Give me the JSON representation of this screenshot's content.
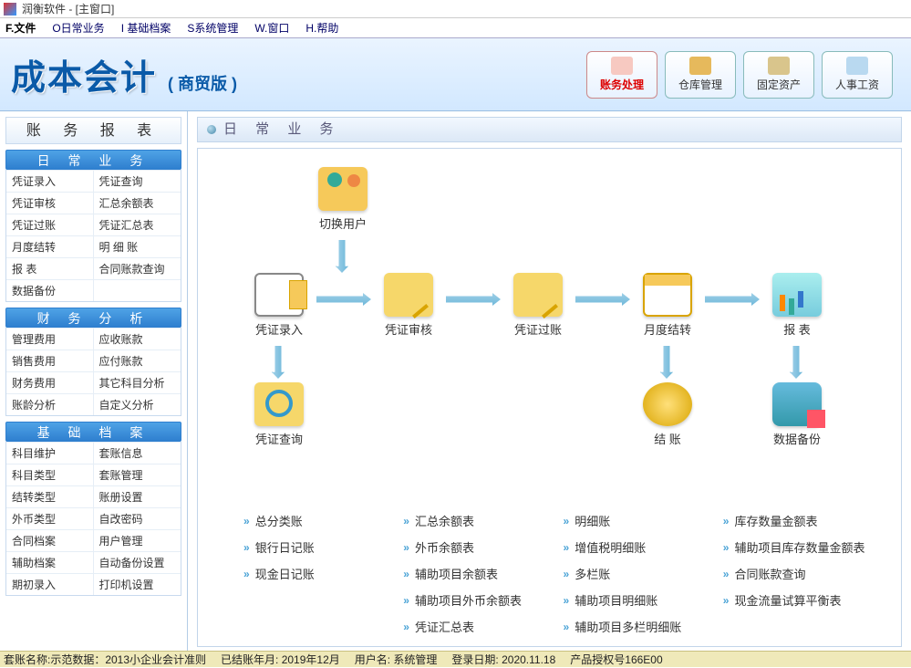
{
  "window": {
    "title": "润衡软件 - [主窗口]"
  },
  "menu": {
    "file": "F.文件",
    "daily": "O日常业务",
    "base": "I 基础档案",
    "system": "S系统管理",
    "window": "W.窗口",
    "help": "H.帮助"
  },
  "brand": {
    "title": "成本会计",
    "edition": "( 商贸版 )"
  },
  "toolbar": {
    "b1": "账务处理",
    "b2": "仓库管理",
    "b3": "固定资产",
    "b4": "人事工资"
  },
  "sidebar": {
    "title": "账 务 报 表",
    "g1": {
      "hdr": "日 常 业 务",
      "items": [
        "凭证录入",
        "凭证查询",
        "凭证审核",
        "汇总余额表",
        "凭证过账",
        "凭证汇总表",
        "月度结转",
        "明 细 账",
        "报    表",
        "合同账款查询",
        "数据备份",
        ""
      ]
    },
    "g2": {
      "hdr": "财 务 分 析",
      "items": [
        "管理费用",
        "应收账款",
        "销售费用",
        "应付账款",
        "财务费用",
        "其它科目分析",
        "账龄分析",
        "自定义分析"
      ]
    },
    "g3": {
      "hdr": "基 础 档 案",
      "items": [
        "科目维护",
        "套账信息",
        "科目类型",
        "套账管理",
        "结转类型",
        "账册设置",
        "外币类型",
        "自改密码",
        "合同档案",
        "用户管理",
        "辅助档案",
        "自动备份设置",
        "期初录入",
        "打印机设置"
      ]
    }
  },
  "content": {
    "title": "日 常 业 务",
    "flow": {
      "switch_user": "切换用户",
      "voucher_input": "凭证录入",
      "voucher_audit": "凭证审核",
      "voucher_post": "凭证过账",
      "month_close": "月度结转",
      "report": "报  表",
      "voucher_query": "凭证查询",
      "settle": "结  账",
      "backup": "数据备份"
    },
    "links": {
      "c1": [
        "总分类账",
        "银行日记账",
        "现金日记账"
      ],
      "c2": [
        "汇总余额表",
        "外币余额表",
        "辅助项目余额表",
        "辅助项目外币余额表",
        "凭证汇总表"
      ],
      "c3": [
        "明细账",
        "增值税明细账",
        "多栏账",
        "辅助项目明细账",
        "辅助项目多栏明细账"
      ],
      "c4": [
        "库存数量金额表",
        "辅助项目库存数量金额表",
        "合同账款查询",
        "现金流量试算平衡表"
      ]
    }
  },
  "status": {
    "s1": "套账名称:示范数据：2013小企业会计准则",
    "s2": "已结账年月: 2019年12月",
    "s3": "用户名: 系统管理",
    "s4": "登录日期: 2020.11.18",
    "s5": "产品授权号166E00"
  }
}
